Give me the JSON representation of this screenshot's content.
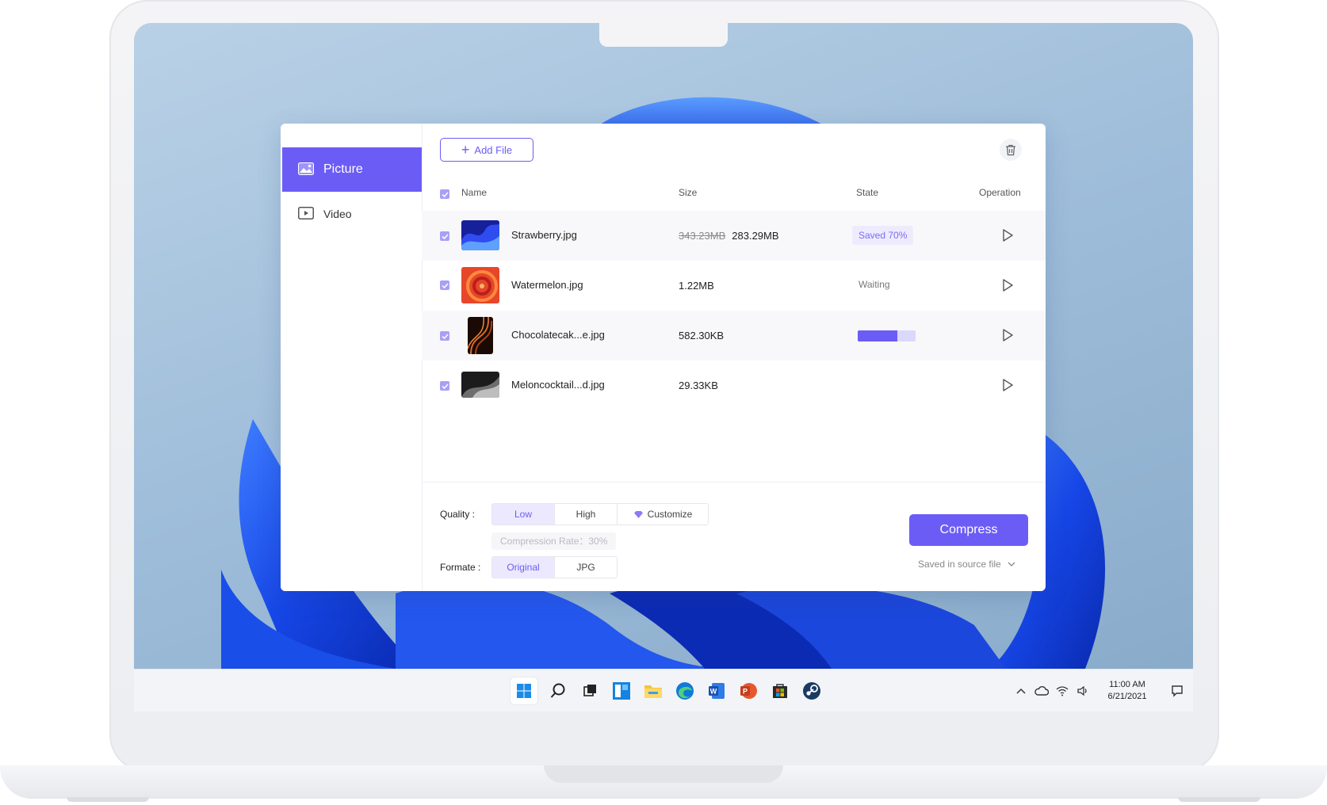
{
  "sidebar": {
    "items": [
      {
        "label": "Picture",
        "icon": "image-icon",
        "active": true
      },
      {
        "label": "Video",
        "icon": "video-icon",
        "active": false
      }
    ]
  },
  "toolbar": {
    "add_file_label": "Add File",
    "trash_icon": "trash-icon"
  },
  "table": {
    "headers": {
      "name": "Name",
      "size": "Size",
      "state": "State",
      "operation": "Operation"
    },
    "rows": [
      {
        "name": "Strawberry.jpg",
        "size_original": "343.23MB",
        "size": "283.29MB",
        "state": "Saved 70%",
        "thumb_color": "#2a3bd6"
      },
      {
        "name": "Watermelon.jpg",
        "size": "1.22MB",
        "state": "Waiting",
        "thumb_color": "#e8462a"
      },
      {
        "name": "Chocolatecak...e.jpg",
        "size": "582.30KB",
        "progress": 0.68,
        "thumb_color": "#3a1a08"
      },
      {
        "name": "Meloncocktail...d.jpg",
        "size": "29.33KB",
        "thumb_color": "#2a2a2a"
      }
    ]
  },
  "settings": {
    "quality_label": "Quality :",
    "quality_options": [
      "Low",
      "High",
      "Customize"
    ],
    "quality_selected": "Low",
    "compression_rate": "Compression Rate：30%",
    "format_label": "Formate :",
    "format_options": [
      "Original",
      "JPG"
    ],
    "format_selected": "Original"
  },
  "actions": {
    "compress_label": "Compress",
    "save_location": "Saved in source file"
  },
  "taskbar": {
    "time": "11:00 AM",
    "date": "6/21/2021"
  },
  "colors": {
    "accent": "#6c5cf6",
    "accent_light": "#ece9fe"
  }
}
